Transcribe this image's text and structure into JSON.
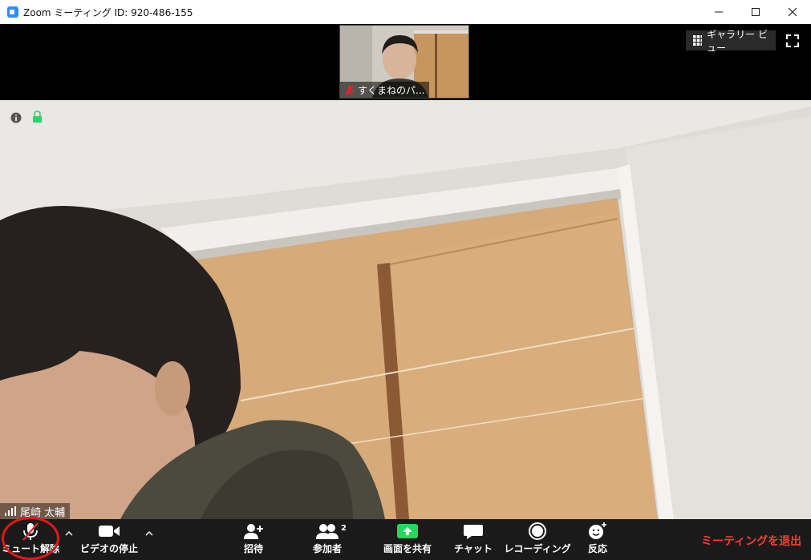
{
  "window": {
    "title": "Zoom ミーティング ID: 920-486-155",
    "controls": {
      "minimize": "—",
      "maximize": "☐",
      "close": "✕"
    }
  },
  "top_strip": {
    "thumbnail_name": "すくまねのパ...",
    "gallery_view_label": "ギャラリー ビュー"
  },
  "main_video": {
    "speaker_name": "尾崎 太輔"
  },
  "toolbar": {
    "unmute_label": "ミュート解除",
    "stop_video_label": "ビデオの停止",
    "invite_label": "招待",
    "participants_label": "参加者",
    "participants_count": "2",
    "share_screen_label": "画面を共有",
    "chat_label": "チャット",
    "recording_label": "レコーディング",
    "reactions_label": "反応",
    "leave_label": "ミーティングを退出"
  },
  "colors": {
    "share_green": "#23d959",
    "leave_red": "#ff3b30",
    "mute_red": "#e02828",
    "toolbar_bg": "#1a1a1a"
  },
  "icons": [
    "zoom-app-icon",
    "grid-icon",
    "fullscreen-icon",
    "info-icon",
    "lock-icon",
    "signal-icon",
    "muted-mic-icon",
    "video-camera-icon",
    "add-user-icon",
    "participants-icon",
    "share-screen-icon",
    "chat-icon",
    "record-icon",
    "reaction-icon"
  ]
}
